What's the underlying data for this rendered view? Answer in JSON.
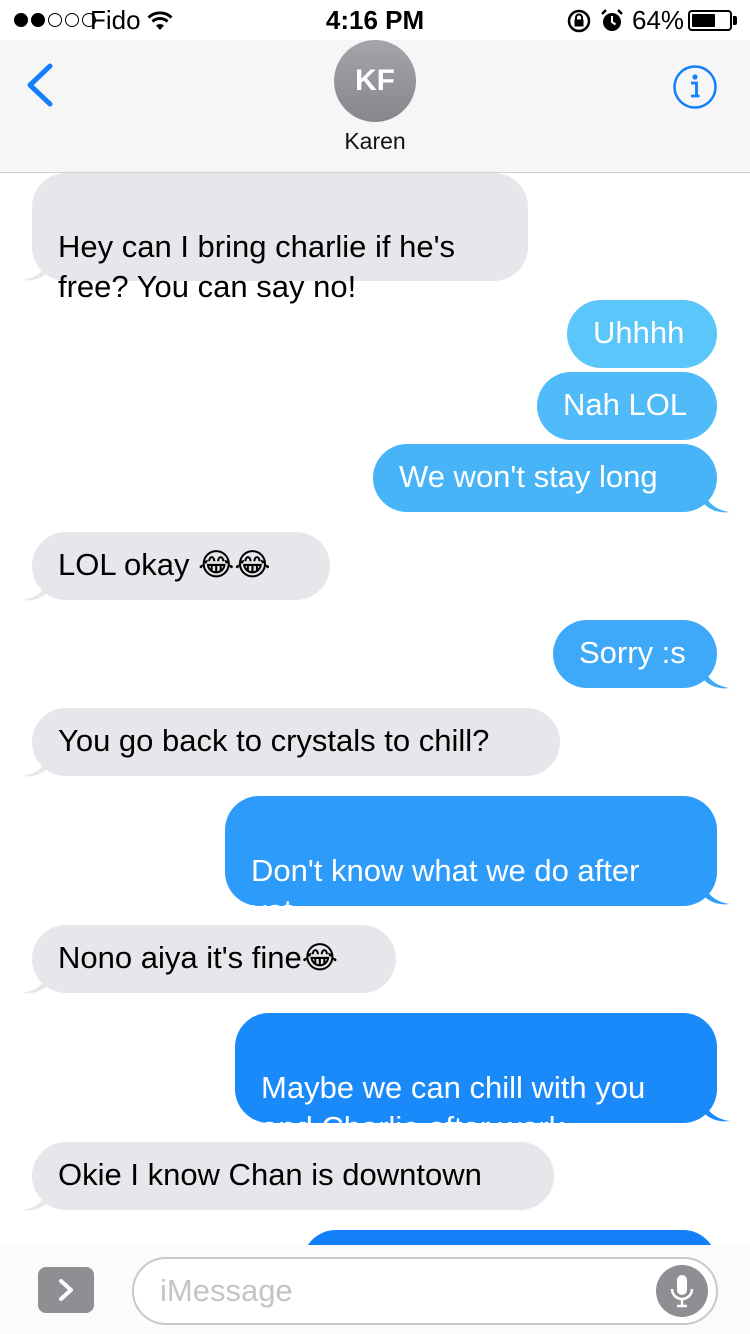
{
  "status_bar": {
    "carrier": "Fido",
    "time": "4:16 PM",
    "battery_percent": "64%",
    "battery_level": 0.64,
    "signal_bars_filled": 2,
    "signal_bars_total": 5
  },
  "header": {
    "avatar_initials": "KF",
    "contact_name": "Karen",
    "icons": [
      "back-chevron-icon",
      "info-icon"
    ]
  },
  "messages": [
    {
      "from": "them",
      "text": "Hey can I bring charlie if he's\nfree? You can say no!"
    },
    {
      "from": "me",
      "text": "Uhhhh"
    },
    {
      "from": "me",
      "text": "Nah LOL"
    },
    {
      "from": "me",
      "text": "We won't stay long"
    },
    {
      "from": "them",
      "text": "LOL okay  😂😂"
    },
    {
      "from": "me",
      "text": "Sorry :s"
    },
    {
      "from": "them",
      "text": "You go back to crystals to chill?"
    },
    {
      "from": "me",
      "text": "Don't know what we do after\nyet"
    },
    {
      "from": "them",
      "text": "Nono aiya it's fine😂"
    },
    {
      "from": "me",
      "text": "Maybe we can chill with you\nand Charlie after work"
    },
    {
      "from": "them",
      "text": "Okie I know Chan is downtown"
    }
  ],
  "input_bar": {
    "placeholder": "iMessage",
    "icons": [
      "apps-chevron-icon",
      "microphone-icon"
    ]
  },
  "colors": {
    "sent_top": "#5ac8fa",
    "sent_bottom": "#1a82fb",
    "received": "#e6e6eb",
    "accent": "#147efb"
  }
}
